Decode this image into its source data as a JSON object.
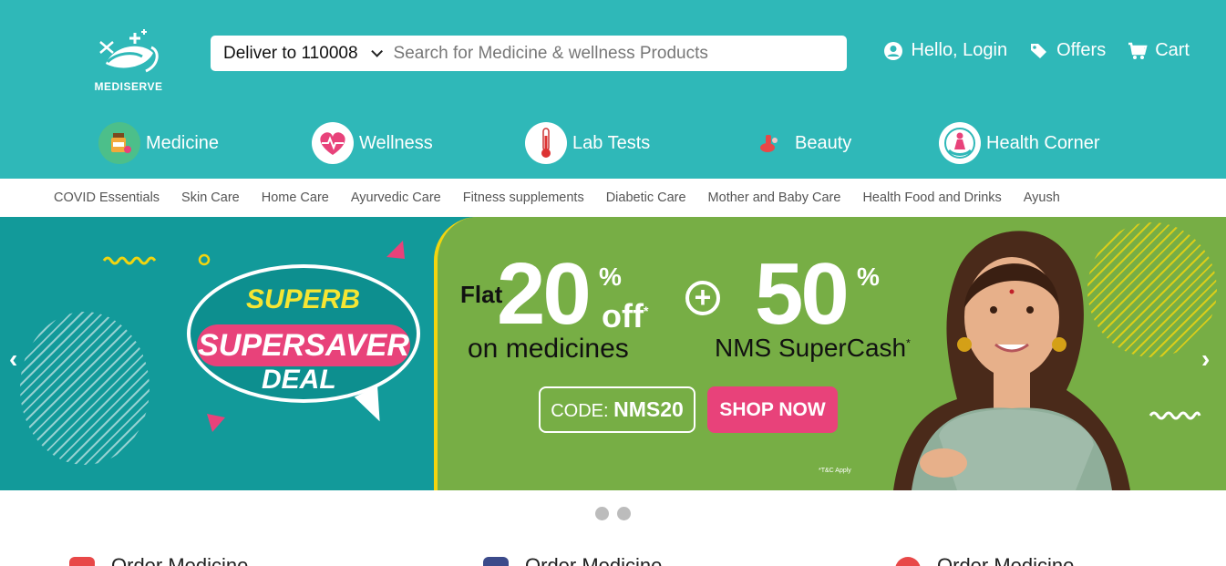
{
  "brand": {
    "name": "MEDISERVE"
  },
  "search": {
    "deliver_label": "Deliver to 110008",
    "placeholder": "Search for Medicine & wellness Products"
  },
  "header_actions": [
    {
      "label": "Hello, Login",
      "icon": "user-icon"
    },
    {
      "label": "Offers",
      "icon": "tags-icon"
    },
    {
      "label": "Cart",
      "icon": "cart-icon"
    }
  ],
  "categories": [
    {
      "label": "Medicine",
      "icon": "medicine-icon"
    },
    {
      "label": "Wellness",
      "icon": "heart-icon"
    },
    {
      "label": "Lab Tests",
      "icon": "thermometer-icon"
    },
    {
      "label": "Beauty",
      "icon": "beauty-icon"
    },
    {
      "label": "Health Corner",
      "icon": "health-corner-icon"
    }
  ],
  "subnav": [
    "COVID Essentials",
    "Skin Care",
    "Home Care",
    "Ayurvedic Care",
    "Fitness supplements",
    "Diabetic Care",
    "Mother and Baby Care",
    "Health Food and Drinks",
    "Ayush"
  ],
  "banner": {
    "superb": "SUPERB",
    "supersaver": "SUPERSAVER",
    "deal": "DEAL",
    "flat": "Flat",
    "discount": "20",
    "percent": "%",
    "off": "off",
    "asterisk": "*",
    "on_medicines": "on medicines",
    "plus": "+",
    "cashback": "50",
    "supercash": "NMS SuperCash",
    "code_label": "CODE:",
    "code": "NMS20",
    "shop_now": "SHOP NOW",
    "tnc": "*T&C Apply",
    "prev": "‹",
    "next": "›"
  },
  "order_sections": [
    "Order Medicine",
    "Order Medicine",
    "Order Medicine"
  ],
  "colors": {
    "header": "#2fb8b8",
    "banner_teal": "#129a9a",
    "banner_green": "#77ae45",
    "pink": "#e8427a",
    "yellow": "#f2d50f"
  }
}
